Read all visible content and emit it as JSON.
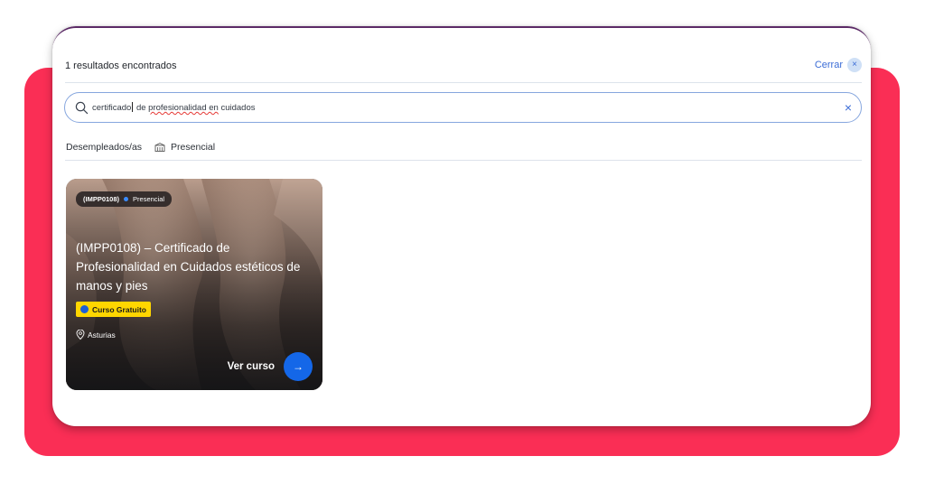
{
  "panel": {
    "results_count": "1 resultados encontrados",
    "close_label": "Cerrar",
    "close_icon": "×"
  },
  "search": {
    "text_part1": "certificado",
    "text_part2": " de ",
    "text_part3": "profesionalidad en",
    "text_part4": " cuidados",
    "clear_icon": "×"
  },
  "filters": {
    "audience": "Desempleados/as",
    "modality": "Presencial"
  },
  "course_card": {
    "code": "(IMPP0108)",
    "modality": "Presencial",
    "title": "(IMPP0108) – Certificado de Profesionalidad en Cuidados estéticos de manos y pies",
    "badge": "Curso Gratuito",
    "location": "Asturias",
    "cta_label": "Ver curso",
    "cta_icon": "→"
  },
  "colors": {
    "backdrop": "#fa2e55",
    "accent_blue": "#1467e8",
    "badge_yellow": "#ffd600"
  }
}
